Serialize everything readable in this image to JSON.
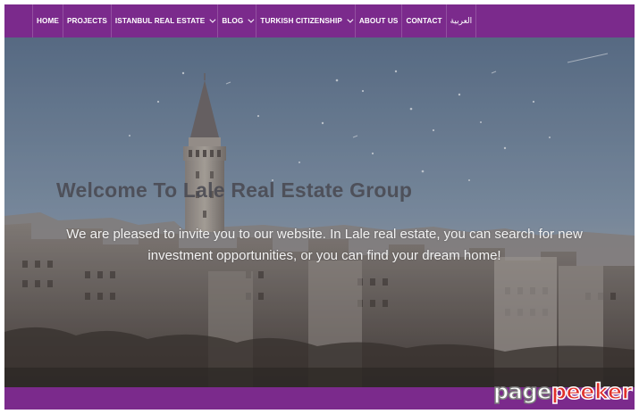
{
  "nav": {
    "items": [
      {
        "label": "HOME",
        "has_dropdown": false
      },
      {
        "label": "PROJECTS",
        "has_dropdown": false
      },
      {
        "label": "ISTANBUL REAL ESTATE",
        "has_dropdown": true
      },
      {
        "label": "BLOG",
        "has_dropdown": true
      },
      {
        "label": "TURKISH CITIZENSHIP",
        "has_dropdown": true
      },
      {
        "label": "ABOUT US",
        "has_dropdown": false
      },
      {
        "label": "CONTACT",
        "has_dropdown": false
      },
      {
        "label": "العربية",
        "has_dropdown": false
      }
    ]
  },
  "hero": {
    "title": "Welcome To Lale Real Estate Group",
    "text": "We are pleased to invite you to our website. In Lale real estate, you can search for new investment opportunities, or you can find your dream home!"
  },
  "watermark": {
    "part1": "page",
    "part2": "peeker"
  },
  "colors": {
    "brand_purple": "#7b2a8c",
    "sky": "#7a8fa6",
    "watermark_red": "#e0302a"
  },
  "icons": {
    "dropdown": "chevron-down-icon"
  }
}
